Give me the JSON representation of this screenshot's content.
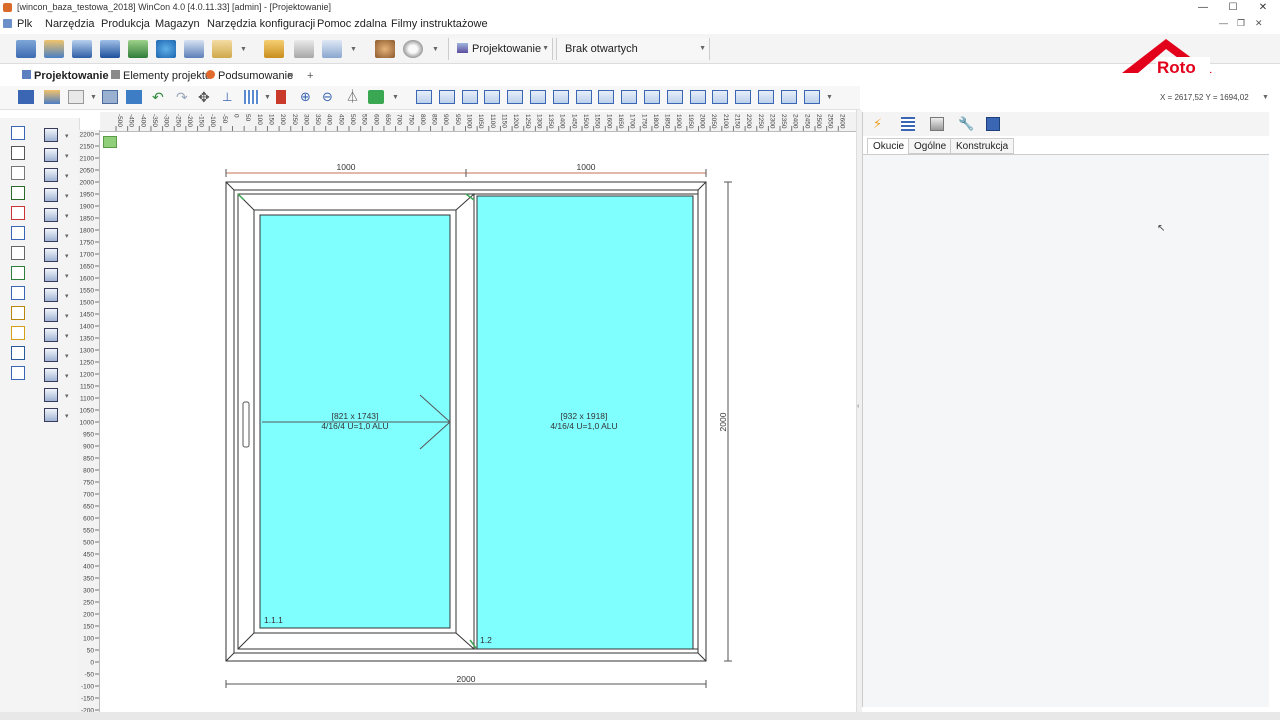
{
  "window": {
    "title": "[wincon_baza_testowa_2018] WinCon 4.0  [4.0.11.33] [admin] - [Projektowanie]",
    "controls": {
      "minimize": "—",
      "maximize": "☐",
      "close": "✕"
    },
    "mdi_controls": {
      "minimize": "—",
      "restore": "❐",
      "close": "✕"
    }
  },
  "menu": {
    "items": [
      "Plk",
      "Narzędzia",
      "Produkcja",
      "Magazyn",
      "Narzędzia konfiguracji",
      "Pomoc zdalna",
      "Filmy instruktażowe"
    ]
  },
  "toolbar": {
    "projektowanie_label": "Projektowanie",
    "documents_label": "Brak otwartych dokumentów"
  },
  "logo": {
    "text": "Roto",
    "color": "#e3001b"
  },
  "tabs": {
    "items": [
      "Projektowanie",
      "Elementy projektu",
      "Podsumowanie"
    ],
    "close": "×",
    "add": "+"
  },
  "coords_readout": "X = 2617,52 Y = 1694,02",
  "rulers": {
    "top": [
      "-500",
      "-450",
      "-400",
      "-350",
      "-300",
      "-250",
      "-200",
      "-150",
      "-100",
      "-50",
      "0",
      "50",
      "100",
      "150",
      "200",
      "250",
      "300",
      "350",
      "400",
      "450",
      "500",
      "550",
      "600",
      "650",
      "700",
      "750",
      "800",
      "850",
      "900",
      "950",
      "1000",
      "1050",
      "1100",
      "1150",
      "1200",
      "1250",
      "1300",
      "1350",
      "1400",
      "1450",
      "1500",
      "1550",
      "1600",
      "1650",
      "1700",
      "1750",
      "1800",
      "1850",
      "1900",
      "1950",
      "2000",
      "2050",
      "2100",
      "2150",
      "2200",
      "2250",
      "2300",
      "2350",
      "2400",
      "2450",
      "2500",
      "2550",
      "2600"
    ],
    "left": [
      "2200",
      "2150",
      "2100",
      "2050",
      "2000",
      "1950",
      "1900",
      "1850",
      "1800",
      "1750",
      "1700",
      "1650",
      "1600",
      "1550",
      "1500",
      "1450",
      "1400",
      "1350",
      "1300",
      "1250",
      "1200",
      "1150",
      "1100",
      "1050",
      "1000",
      "950",
      "900",
      "850",
      "800",
      "750",
      "700",
      "650",
      "600",
      "550",
      "500",
      "450",
      "400",
      "350",
      "300",
      "250",
      "200",
      "150",
      "100",
      "50",
      "0",
      "-50",
      "-100",
      "-150",
      "-200"
    ]
  },
  "drawing": {
    "dim_top_left": "1000",
    "dim_top_right": "1000",
    "dim_bottom": "2000",
    "dim_right": "2000",
    "sash_left": {
      "size": "[821 x 1743]",
      "glass": "4/16/4 U=1,0 ALU",
      "id": "1.1.1"
    },
    "sash_right": {
      "size": "[932 x 1918]",
      "glass": "4/16/4 U=1,0 ALU",
      "id": "1.2"
    },
    "glass_color": "#80ffff",
    "frame_color": "#ffffff"
  },
  "right_panel": {
    "tabs": [
      "Okucie",
      "Ogólne",
      "Konstrukcja"
    ]
  }
}
